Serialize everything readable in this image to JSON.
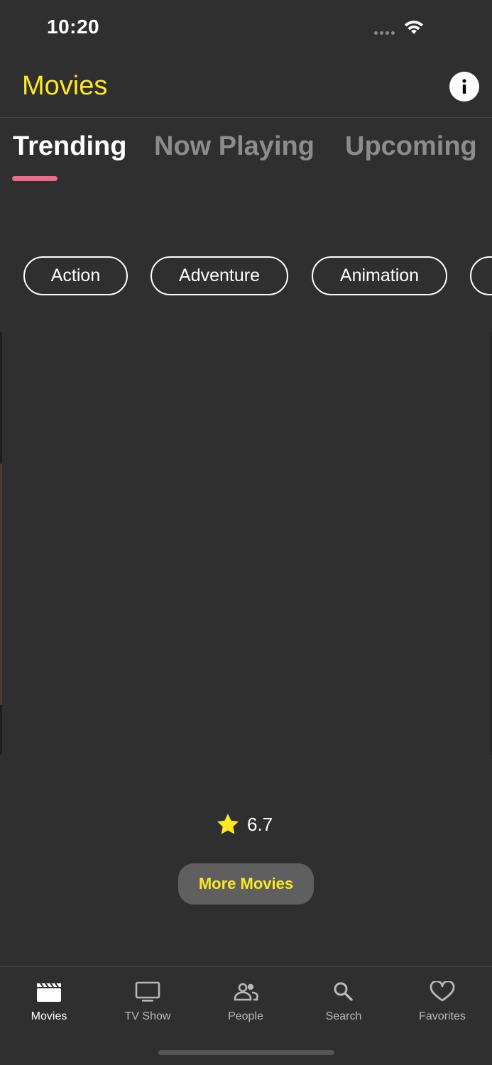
{
  "status_bar": {
    "time": "10:20",
    "icons": [
      "signal-dots-icon",
      "wifi-icon"
    ]
  },
  "header": {
    "title": "Movies",
    "info_icon": "info-icon"
  },
  "tabs": [
    {
      "label": "Trending",
      "active": true
    },
    {
      "label": "Now Playing",
      "active": false
    },
    {
      "label": "Upcoming",
      "active": false
    }
  ],
  "genres": [
    {
      "label": "Action"
    },
    {
      "label": "Adventure"
    },
    {
      "label": "Animation"
    },
    {
      "label": ""
    }
  ],
  "movie": {
    "rating": "6.7",
    "rating_icon": "star-icon"
  },
  "more_button": {
    "label": "More Movies"
  },
  "bottom_nav": [
    {
      "label": "Movies",
      "icon": "clapperboard-icon",
      "active": true
    },
    {
      "label": "TV Show",
      "icon": "tv-icon",
      "active": false
    },
    {
      "label": "People",
      "icon": "people-icon",
      "active": false
    },
    {
      "label": "Search",
      "icon": "search-icon",
      "active": false
    },
    {
      "label": "Favorites",
      "icon": "heart-icon",
      "active": false
    }
  ],
  "colors": {
    "background": "#2f2f2f",
    "accent_yellow": "#fde824",
    "tab_indicator": "#f06a8a",
    "inactive_text": "#8c8c8c",
    "button_bg": "#5f5f5f"
  }
}
